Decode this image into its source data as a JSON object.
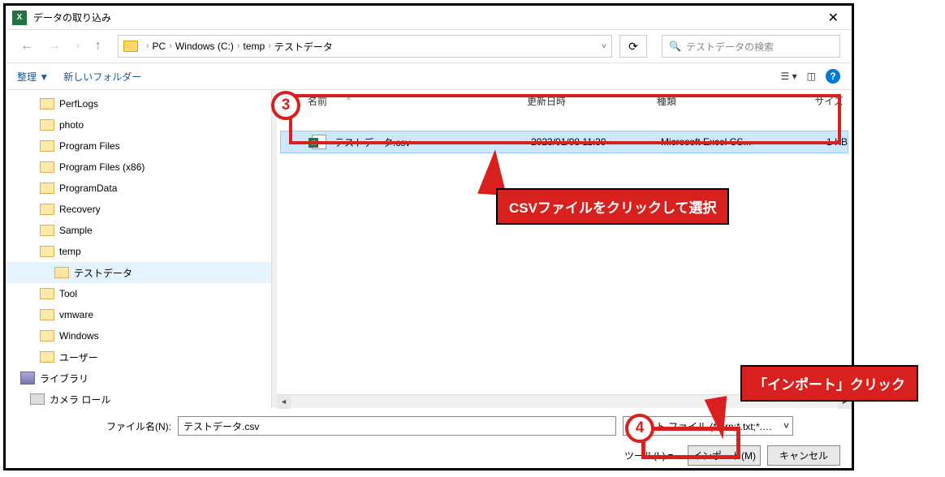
{
  "window": {
    "title": "データの取り込み"
  },
  "breadcrumb": [
    "PC",
    "Windows (C:)",
    "temp",
    "テストデータ"
  ],
  "search": {
    "placeholder": "テストデータの検索"
  },
  "toolbar": {
    "organize": "整理 ▼",
    "newfolder": "新しいフォルダー"
  },
  "tree": {
    "items": [
      "PerfLogs",
      "photo",
      "Program Files",
      "Program Files (x86)",
      "ProgramData",
      "Recovery",
      "Sample",
      "temp",
      "テストデータ",
      "Tool",
      "vmware",
      "Windows",
      "ユーザー"
    ],
    "libraries": "ライブラリ",
    "cameraroll": "カメラ ロール"
  },
  "columns": {
    "name": "名前",
    "date": "更新日時",
    "type": "種類",
    "size": "サイズ"
  },
  "files": [
    {
      "name": "テストデータ.csv",
      "date": "2023/01/08 11:39",
      "type": "Microsoft Excel CS...",
      "size": "1 KB"
    }
  ],
  "filename": {
    "label": "ファイル名(N):",
    "value": "テストデータ.csv"
  },
  "filetype": {
    "value": "テキスト ファイル (*.prn;*.txt;*.csv)"
  },
  "buttons": {
    "tools": "ツール(L)",
    "import": "インポート(M)",
    "cancel": "キャンセル"
  },
  "annotations": {
    "step3": "3",
    "step4": "4",
    "callout1": "CSVファイルをクリックして選択",
    "callout2": "「インポート」クリック"
  }
}
